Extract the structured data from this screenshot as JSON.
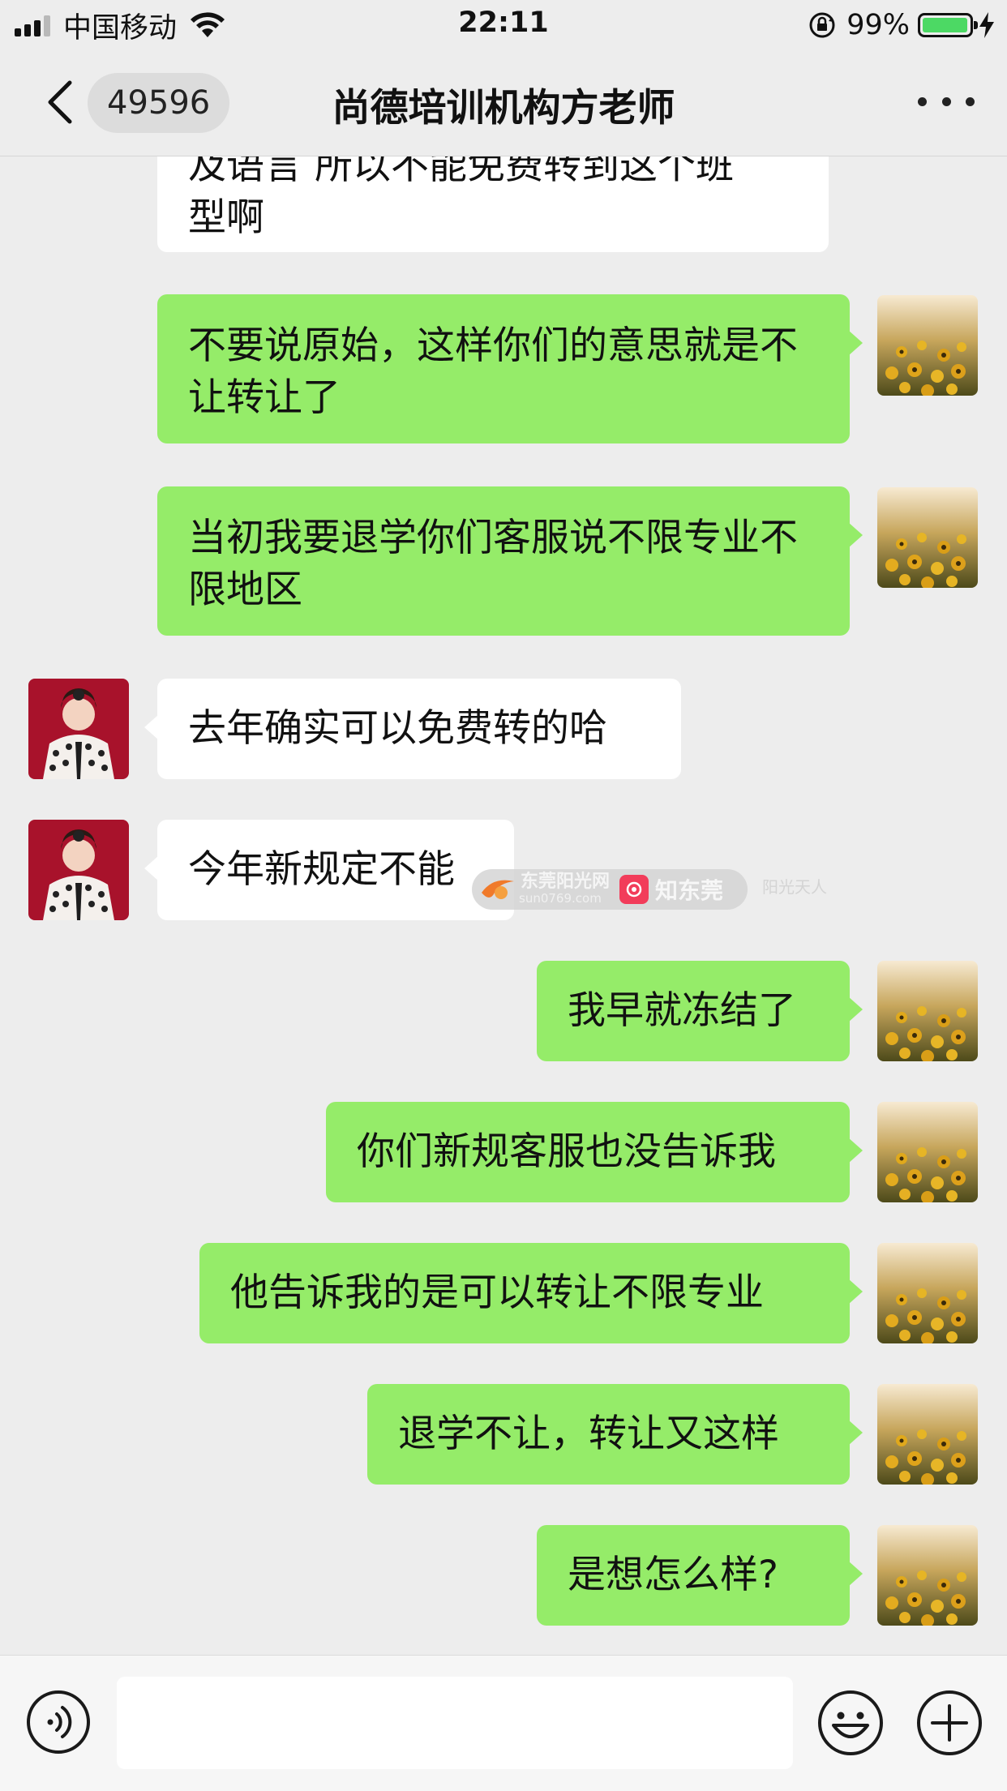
{
  "status_bar": {
    "carrier": "中国移动",
    "time": "22:11",
    "battery_percent": "99%",
    "battery_level": 0.99,
    "signal_bars": 3
  },
  "nav": {
    "unread_count": "49596",
    "title": "尚德培训机构方老师"
  },
  "messages": [
    {
      "side": "left",
      "partial": true,
      "text_top": "及语言 所以不能免费转到这个班",
      "text": "型啊"
    },
    {
      "side": "right",
      "text": "不要说原始，这样你们的意思就是不让转让了"
    },
    {
      "side": "right",
      "text": "当初我要退学你们客服说不限专业不限地区"
    },
    {
      "side": "left",
      "text": "去年确实可以免费转的哈"
    },
    {
      "side": "left",
      "text": "今年新规定不能"
    },
    {
      "side": "right",
      "text": "我早就冻结了"
    },
    {
      "side": "right",
      "text": "你们新规客服也没告诉我"
    },
    {
      "side": "right",
      "text": "他告诉我的是可以转让不限专业"
    },
    {
      "side": "right",
      "text": "退学不让，转让又这样"
    },
    {
      "side": "right",
      "text": "是想怎么样?"
    }
  ],
  "watermark": {
    "site": "东莞阳光网",
    "domain": "sun0769.com",
    "brand": "知东莞",
    "faint": "阳光天人"
  },
  "input": {
    "value": "",
    "placeholder": ""
  },
  "icons": {
    "back": "chevron-left-icon",
    "more": "more-dots-icon",
    "voice": "voice-icon",
    "emoji": "emoji-icon",
    "plus": "plus-icon"
  },
  "colors": {
    "background": "#ededed",
    "sent_bubble": "#95ec69",
    "received_bubble": "#ffffff",
    "battery": "#4cd964"
  }
}
